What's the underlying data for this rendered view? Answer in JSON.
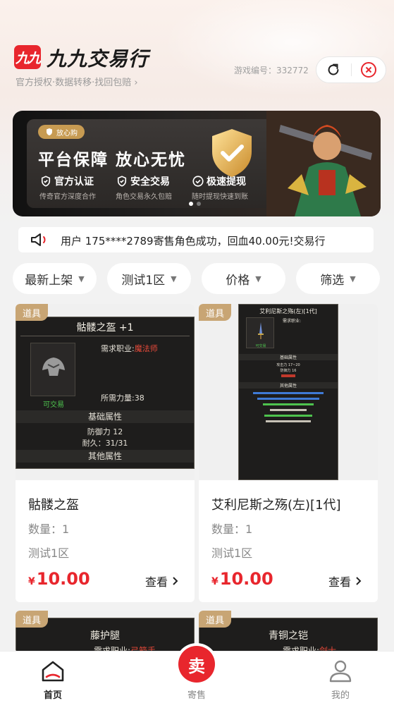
{
  "header": {
    "logo_mark": "九九",
    "app_name": "九九交易行",
    "slogan": "官方授权·数据转移·找回包赔 ›",
    "game_id": "游戏编号：332772"
  },
  "banner": {
    "tag": "放心购",
    "title": "平台保障 放心无忧",
    "features": [
      {
        "label": "官方认证",
        "sub": "传奇官方深度合作"
      },
      {
        "label": "安全交易",
        "sub": "角色交易永久包赔"
      },
      {
        "label": "极速提现",
        "sub": "随时提现快速到账"
      }
    ]
  },
  "notice": {
    "text": "用户 175****2789寄售角色成功，回血40.00元!交易行"
  },
  "filters": [
    {
      "label": "最新上架"
    },
    {
      "label": "测试1区"
    },
    {
      "label": "价格"
    },
    {
      "label": "筛选"
    }
  ],
  "items": [
    {
      "tag": "道具",
      "name": "骷髅之盔",
      "qty": "数量：1",
      "zone": "测试1区",
      "currency": "¥",
      "price": "10.00",
      "view": "查看",
      "shot": {
        "title": "骷髅之盔 +1",
        "req_label": "需求职业:",
        "req_value": "魔法师",
        "tradable": "可交易",
        "strength": "所需力量:38",
        "section1": "基础属性",
        "defense": "防御力 12",
        "durability": "耐久：31/31",
        "section2": "其他属性"
      }
    },
    {
      "tag": "道具",
      "name": "艾利尼斯之殇(左)[1代]",
      "qty": "数量：1",
      "zone": "测试1区",
      "currency": "¥",
      "price": "10.00",
      "view": "查看",
      "shot": {
        "title": "艾利尼斯之殇(左)[1代]",
        "req_label": "需求职业:",
        "tradable": "可交易",
        "section1": "基础属性",
        "attack": "攻击力 17~20",
        "defense": "防御力 16",
        "section2": "其他属性"
      }
    },
    {
      "tag": "道具",
      "shot": {
        "title": "藤护腿",
        "req_label": "需求职业:",
        "req_value": "弓箭手"
      }
    },
    {
      "tag": "道具",
      "shot": {
        "title": "青铜之铠",
        "req_label": "需求职业:",
        "req_value": "剑士"
      }
    }
  ],
  "tabbar": {
    "home": "首页",
    "sell_icon": "卖",
    "sell": "寄售",
    "mine": "我的"
  },
  "colors": {
    "accent": "#e8262d",
    "tag": "#c8a574",
    "gold": "#c79b52"
  }
}
